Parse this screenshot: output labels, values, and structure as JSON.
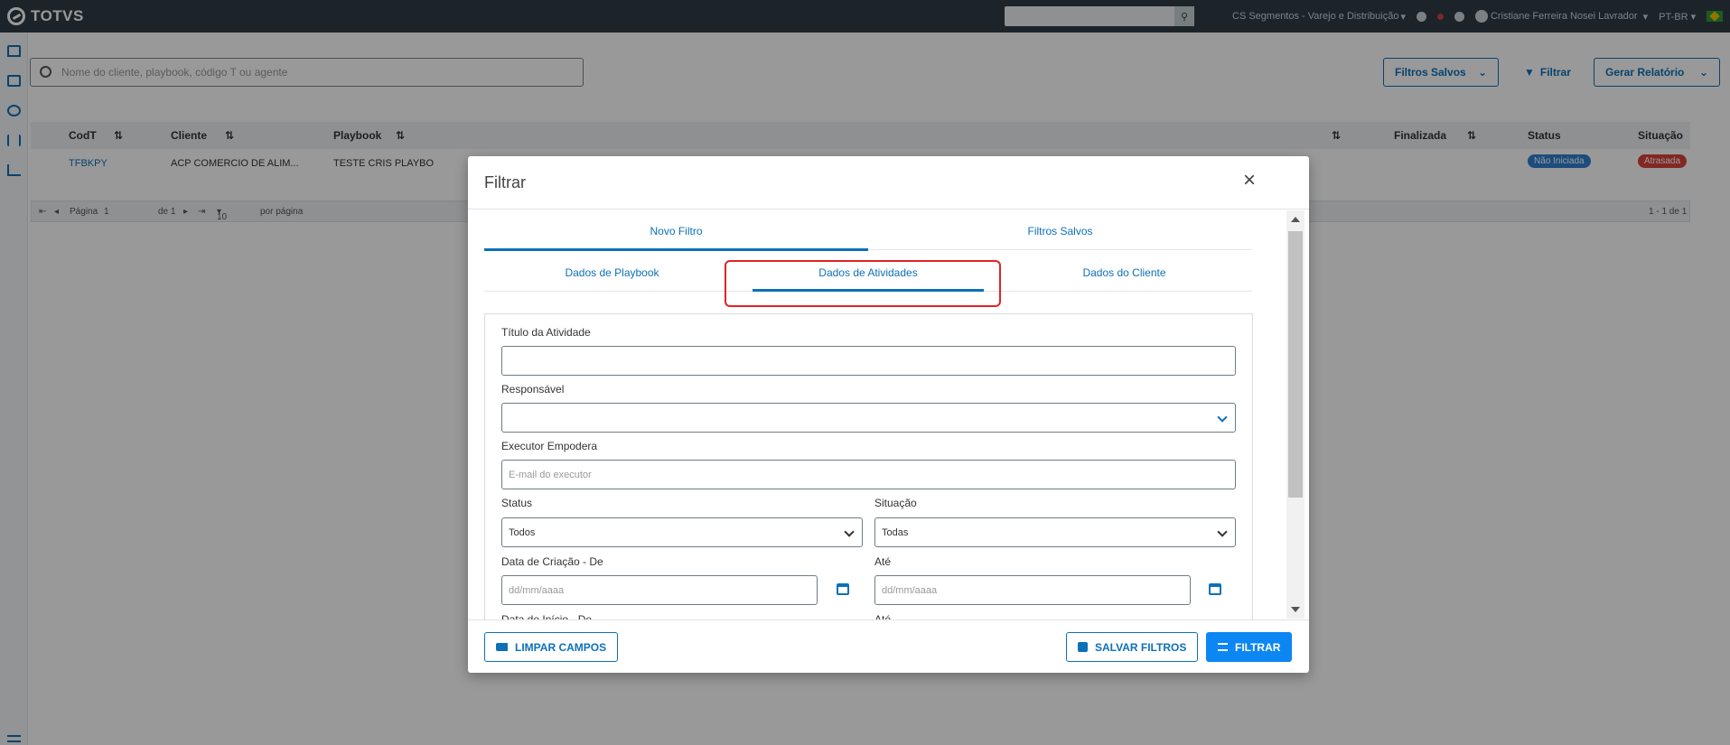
{
  "topbar": {
    "logo": "TOTVS",
    "segment": "CS Segmentos - Varejo e Distribuição",
    "user": "Cristiane Ferreira Nosei Lavrador",
    "language": "PT-BR"
  },
  "main": {
    "search_placeholder": "Nome do cliente, playbook, código T ou agente",
    "saved_filters_btn": "Filtros Salvos",
    "filter_btn": "Filtrar",
    "report_btn": "Gerar Relatório",
    "table": {
      "headers": [
        "CodT",
        "Cliente",
        "Playbook",
        "Finalizada",
        "Status",
        "Situação"
      ],
      "row": {
        "codt": "TFBKPY",
        "cliente": "ACP COMERCIO DE ALIM...",
        "playbook": "TESTE CRIS PLAYBO",
        "status": "Não Iniciada",
        "situacao": "Atrasada"
      }
    },
    "pager": {
      "page_label": "Página",
      "page_value": "1",
      "of_label": "de 1",
      "per_page_value": "10",
      "per_page_label": "por página",
      "range": "1 - 1 de 1"
    }
  },
  "modal": {
    "title": "Filtrar",
    "tabs": [
      "Novo Filtro",
      "Filtros Salvos"
    ],
    "subtabs": [
      "Dados de Playbook",
      "Dados de Atividades",
      "Dados do Cliente"
    ],
    "fields": {
      "titulo_label": "Título da Atividade",
      "responsavel_label": "Responsável",
      "executor_label": "Executor Empodera",
      "executor_placeholder": "E-mail do executor",
      "status_label": "Status",
      "status_value": "Todos",
      "situacao_label": "Situação",
      "situacao_value": "Todas",
      "criacao_de_label": "Data de Criação - De",
      "criacao_ate_label": "Até",
      "date_placeholder": "dd/mm/aaaa",
      "inicio_de_label": "Data de Início - De",
      "inicio_ate_label": "Até"
    },
    "buttons": {
      "clear": "LIMPAR CAMPOS",
      "save": "SALVAR FILTROS",
      "filter": "FILTRAR"
    }
  },
  "colors": {
    "primary": "#0c71b8",
    "primary_button": "#0c86f2",
    "topbar": "#2f3d46",
    "highlight": "#e02424",
    "badge_status": "#2f7fd0",
    "badge_situacao": "#d9443b"
  }
}
